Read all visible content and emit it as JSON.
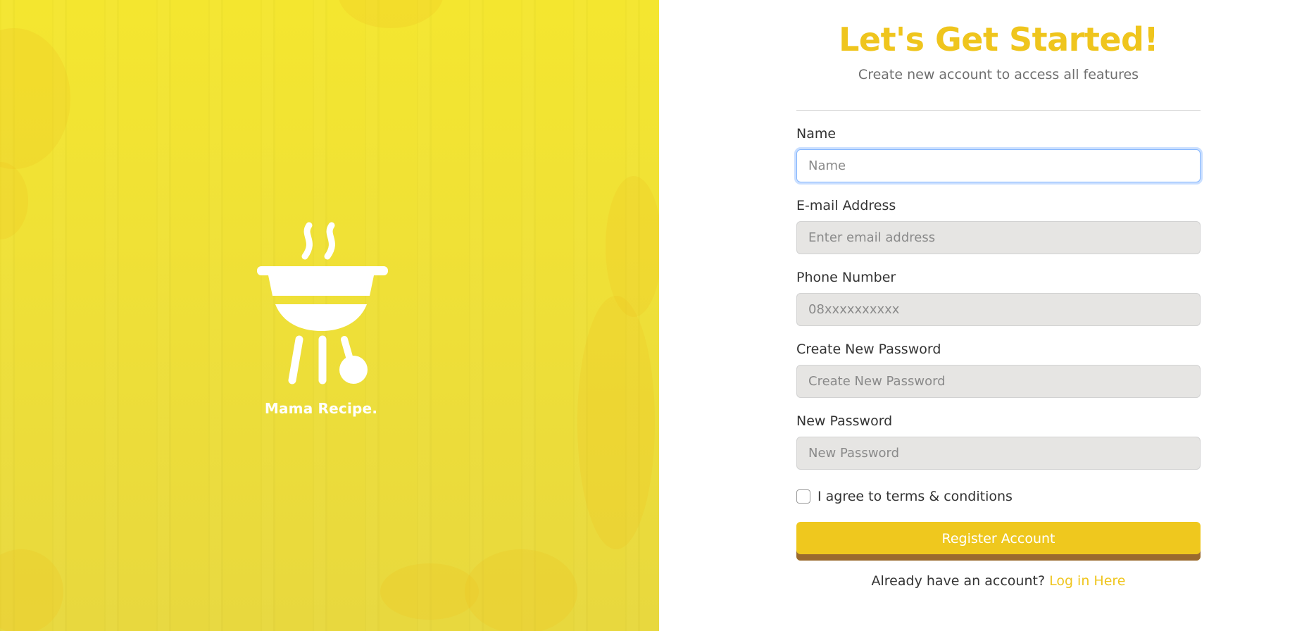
{
  "brand": {
    "name": "Mama Recipe.",
    "icon": "grill-icon"
  },
  "header": {
    "title": "Let's Get Started!",
    "subtitle": "Create new account to access all features"
  },
  "form": {
    "name": {
      "label": "Name",
      "placeholder": "Name",
      "value": ""
    },
    "email": {
      "label": "E-mail Address",
      "placeholder": "Enter email address",
      "value": ""
    },
    "phone": {
      "label": "Phone Number",
      "placeholder": "08xxxxxxxxxx",
      "value": ""
    },
    "create_password": {
      "label": "Create New Password",
      "placeholder": "Create New Password",
      "value": ""
    },
    "new_password": {
      "label": "New Password",
      "placeholder": "New Password",
      "value": ""
    },
    "agree": {
      "label": "I agree to terms & conditions",
      "checked": false
    },
    "submit_label": "Register Account"
  },
  "footer": {
    "prompt": "Already have an account?",
    "link_label": "Log in Here"
  },
  "colors": {
    "accent": "#efc51d",
    "banner": "#f1e235",
    "button_shadow": "#9a6a2e"
  }
}
